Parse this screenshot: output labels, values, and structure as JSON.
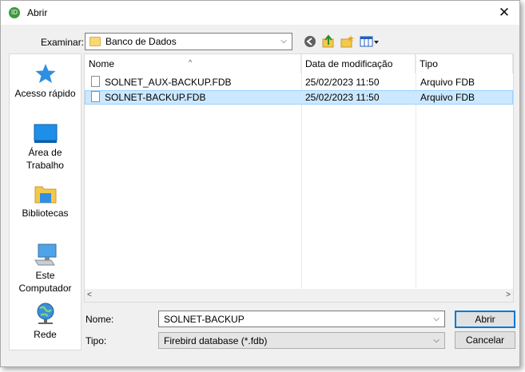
{
  "window": {
    "title": "Abrir",
    "close_glyph": "✕",
    "app_icon_text": "ID"
  },
  "location": {
    "label": "Examinar:",
    "value": "Banco de Dados"
  },
  "places": [
    {
      "label_lines": [
        "Acesso rápido"
      ],
      "icon": "quick-access-star-icon"
    },
    {
      "label_lines": [
        "Área de",
        "Trabalho"
      ],
      "icon": "desktop-icon"
    },
    {
      "label_lines": [
        "Bibliotecas"
      ],
      "icon": "libraries-icon"
    },
    {
      "label_lines": [
        "Este",
        "Computador"
      ],
      "icon": "computer-icon"
    },
    {
      "label_lines": [
        "Rede"
      ],
      "icon": "network-globe-icon"
    }
  ],
  "columns": [
    "Nome",
    "Data de modificação",
    "Tipo"
  ],
  "files": [
    {
      "name": "SOLNET_AUX-BACKUP.FDB",
      "modified": "25/02/2023 11:50",
      "type": "Arquivo FDB",
      "selected": false
    },
    {
      "name": "SOLNET-BACKUP.FDB",
      "modified": "25/02/2023 11:50",
      "type": "Arquivo FDB",
      "selected": true
    }
  ],
  "filename": {
    "label": "Nome:",
    "value": "SOLNET-BACKUP"
  },
  "filetype": {
    "label": "Tipo:",
    "value": "Firebird database (*.fdb)"
  },
  "buttons": {
    "open": "Abrir",
    "cancel": "Cancelar"
  },
  "colors": {
    "selection": "#cce8ff",
    "selection_border": "#99d1ff",
    "accent": "#0078d7"
  }
}
